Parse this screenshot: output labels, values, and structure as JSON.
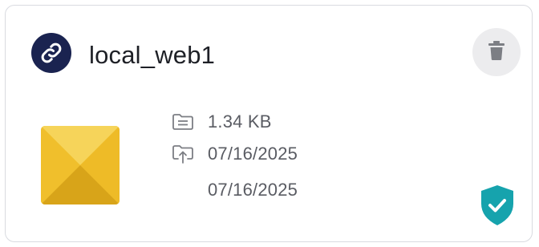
{
  "card": {
    "title": "local_web1",
    "size": "1.34 KB",
    "uploaded_date": "07/16/2025",
    "modified_date": "07/16/2025"
  },
  "icons": {
    "badge": "link-icon",
    "delete": "trash-icon",
    "size": "file-size-icon",
    "upload": "upload-icon",
    "status": "shield-check-icon"
  },
  "colors": {
    "badge_bg": "#1a2350",
    "title_text": "#1e2026",
    "meta_text": "#5a5c63",
    "delete_bg": "#ececee",
    "shield": "#16a3ad",
    "thumb_primary": "#f1c22c"
  }
}
